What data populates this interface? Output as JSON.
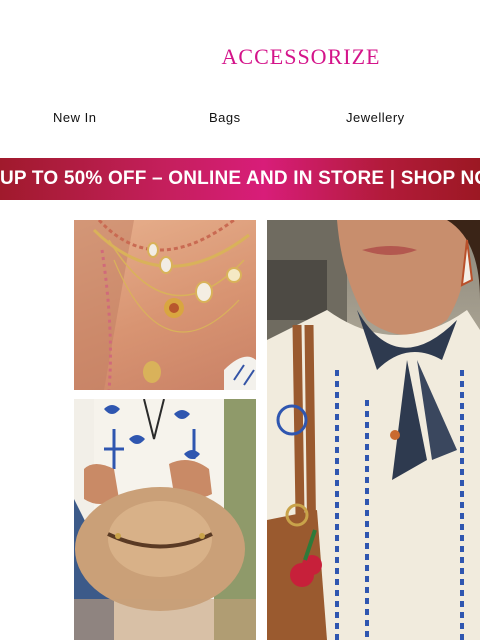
{
  "brand": {
    "logo_text": "ACCESSORIZE",
    "color": "#d4148a"
  },
  "nav": {
    "items": [
      {
        "label": "New In"
      },
      {
        "label": "Bags"
      },
      {
        "label": "Jewellery"
      }
    ]
  },
  "promo": {
    "text": "UP TO 50% OFF – ONLINE AND IN STORE | SHOP NO"
  },
  "images": [
    {
      "icon": "layered-gold-necklaces-image"
    },
    {
      "icon": "straw-fedora-hat-image"
    },
    {
      "icon": "model-with-bandana-and-bag-image"
    }
  ]
}
